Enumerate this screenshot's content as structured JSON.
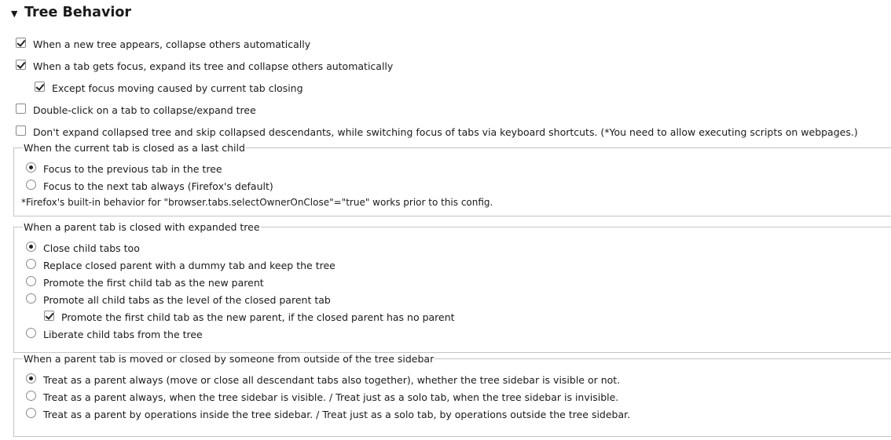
{
  "section": {
    "title": "Tree Behavior",
    "twisty": "▼"
  },
  "options": [
    {
      "label": "When a new tree appears, collapse others automatically",
      "checked": true
    },
    {
      "label": "When a tab gets focus, expand its tree and collapse others automatically",
      "checked": true
    },
    {
      "label": "Except focus moving caused by current tab closing",
      "checked": true
    },
    {
      "label": "Double-click on a tab to collapse/expand tree",
      "checked": false
    },
    {
      "label": "Don't expand collapsed tree and skip collapsed descendants, while switching focus of tabs via keyboard shortcuts. (*You need to allow executing scripts on webpages.)",
      "checked": false
    }
  ],
  "group_last_child": {
    "legend": "When the current tab is closed as a last child",
    "items": [
      {
        "label": "Focus to the previous tab in the tree",
        "selected": true
      },
      {
        "label": "Focus to the next tab always (Firefox's default)",
        "selected": false
      }
    ],
    "note": "*Firefox's built-in behavior for \"browser.tabs.selectOwnerOnClose\"=\"true\" works prior to this config."
  },
  "group_parent_closed": {
    "legend": "When a parent tab is closed with expanded tree",
    "items": [
      {
        "label": "Close child tabs too",
        "selected": true
      },
      {
        "label": "Replace closed parent with a dummy tab and keep the tree",
        "selected": false
      },
      {
        "label": "Promote the first child tab as the new parent",
        "selected": false
      },
      {
        "label": "Promote all child tabs as the level of the closed parent tab",
        "selected": false
      },
      {
        "label": "Liberate child tabs from the tree",
        "selected": false
      }
    ],
    "sub_option": {
      "label": "Promote the first child tab as the new parent, if the closed parent has no parent",
      "checked": true
    }
  },
  "group_outside": {
    "legend": "When a parent tab is moved or closed by someone from outside of the tree sidebar",
    "items": [
      {
        "label": "Treat as a parent always (move or close all descendant tabs also together), whether the tree sidebar is visible or not.",
        "selected": true
      },
      {
        "label": "Treat as a parent always, when the tree sidebar is visible. / Treat just as a solo tab, when the tree sidebar is invisible.",
        "selected": false
      },
      {
        "label": "Treat as a parent by operations inside the tree sidebar. / Treat just as a solo tab, by operations outside the tree sidebar.",
        "selected": false
      }
    ]
  }
}
